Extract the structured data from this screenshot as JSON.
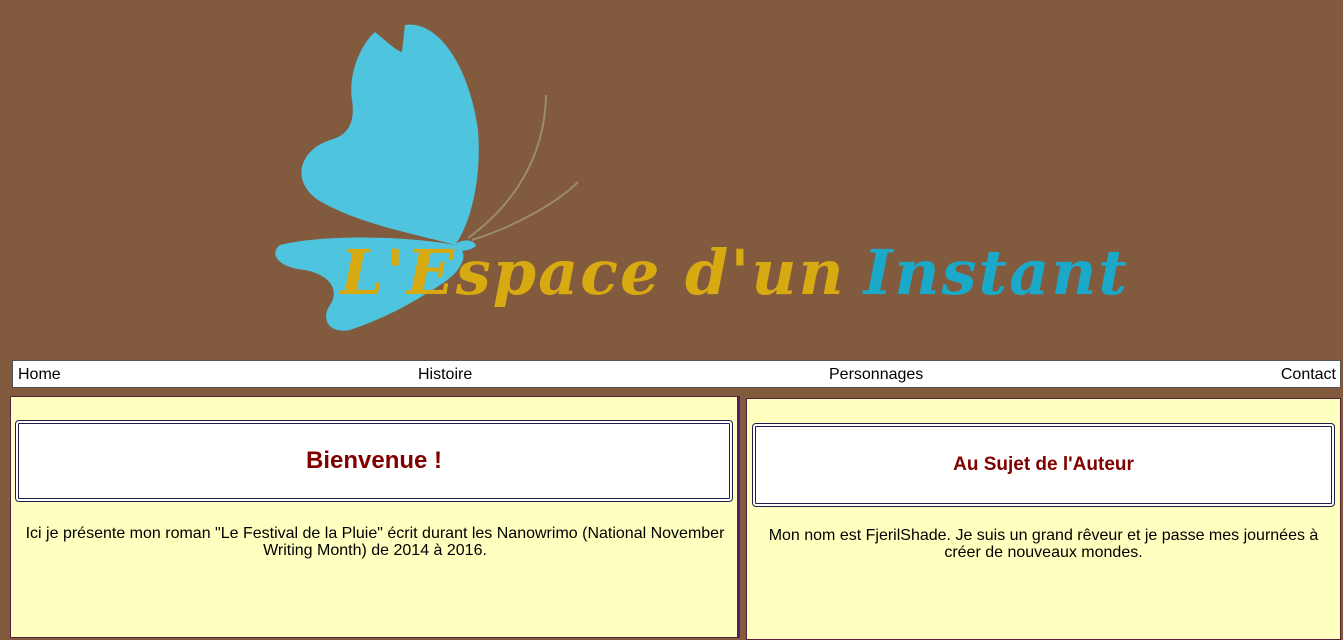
{
  "header": {
    "logo_part1": "L'Espace d'un",
    "logo_part2": "Instant",
    "icon": "butterfly-logo",
    "colors": {
      "background": "#825A3E",
      "butterfly": "#4FC4DF",
      "gold": "#D8AA12",
      "teal": "#1AA9C9"
    }
  },
  "nav": {
    "items": [
      {
        "label": "Home"
      },
      {
        "label": "Histoire"
      },
      {
        "label": "Personnages"
      },
      {
        "label": "Contact"
      }
    ]
  },
  "left_panel": {
    "title": "Bienvenue !",
    "text": "Ici je présente mon roman \"Le Festival de la Pluie\" écrit durant les Nanowrimo (National November Writing Month) de 2014 à 2016."
  },
  "right_panel": {
    "title": "Au Sujet de l'Auteur",
    "text": "Mon nom est FjerilShade. Je suis un grand rêveur et je passe mes journées à créer de nouveaux mondes."
  },
  "colors": {
    "panel_bg": "#FFFFC0",
    "title_color": "#800000",
    "title_border": "#1C1C50"
  }
}
